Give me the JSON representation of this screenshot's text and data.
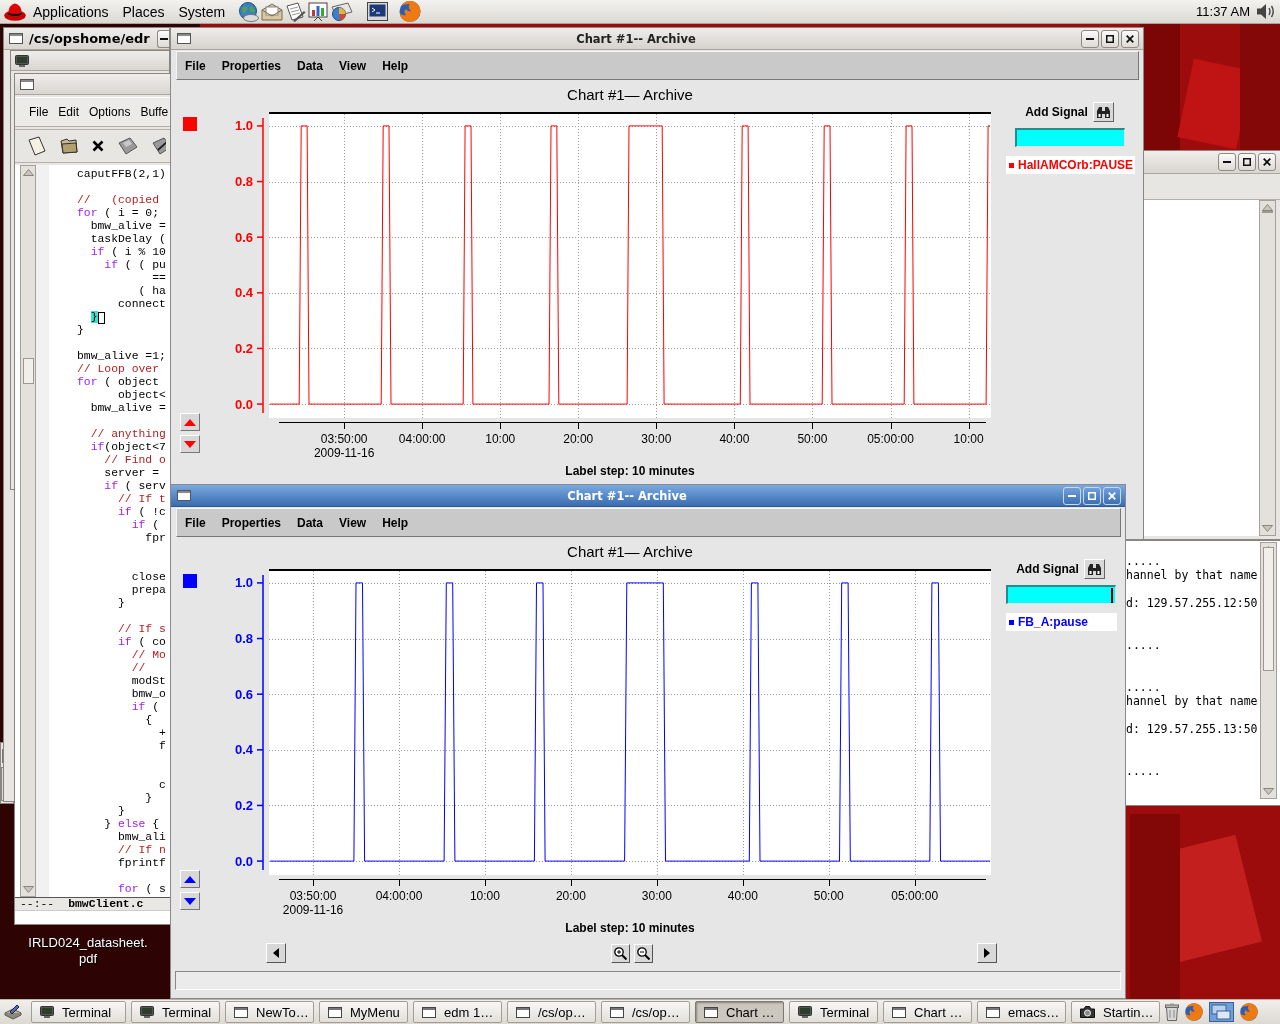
{
  "top_panel": {
    "menus": [
      "Applications",
      "Places",
      "System"
    ],
    "clock": "11:37 AM"
  },
  "desktop_icon": {
    "label": "IRLD024_datasheet.pdf"
  },
  "terminal_window": {
    "title": "/cs/opshome/edr"
  },
  "editor": {
    "menu": [
      "File",
      "Edit",
      "Options",
      "Buffe"
    ],
    "lines": [
      {
        "kind": "code",
        "parts": [
          {
            "text": "caputFFB(2,1)",
            "kind": "plain"
          }
        ]
      },
      {
        "kind": "blank"
      },
      {
        "kind": "code",
        "parts": [
          {
            "text": "//   (copied",
            "kind": "comment"
          }
        ]
      },
      {
        "kind": "code",
        "parts": [
          {
            "text": "for",
            "kind": "keyword"
          },
          {
            "text": " ( i = 0;",
            "kind": "plain"
          }
        ]
      },
      {
        "kind": "code",
        "parts": [
          {
            "text": "  bmw_alive =",
            "kind": "plain"
          }
        ]
      },
      {
        "kind": "code",
        "parts": [
          {
            "text": "  taskDelay (",
            "kind": "plain"
          }
        ]
      },
      {
        "kind": "code",
        "parts": [
          {
            "text": "  if",
            "kind": "keyword"
          },
          {
            "text": " ( i % 10",
            "kind": "plain"
          }
        ]
      },
      {
        "kind": "code",
        "parts": [
          {
            "text": "    if",
            "kind": "keyword"
          },
          {
            "text": " ( ( pu",
            "kind": "plain"
          }
        ]
      },
      {
        "kind": "code",
        "parts": [
          {
            "text": "           ==",
            "kind": "plain"
          }
        ]
      },
      {
        "kind": "code",
        "parts": [
          {
            "text": "         ( ha",
            "kind": "plain"
          }
        ]
      },
      {
        "kind": "code",
        "parts": [
          {
            "text": "      connect",
            "kind": "plain"
          }
        ]
      },
      {
        "kind": "code",
        "parts": [
          {
            "text": "  }",
            "kind": "match"
          },
          {
            "kind": "cursor"
          }
        ]
      },
      {
        "kind": "code",
        "parts": [
          {
            "text": "}",
            "kind": "plain"
          }
        ]
      },
      {
        "kind": "blank"
      },
      {
        "kind": "code",
        "parts": [
          {
            "text": "bmw_alive =1;",
            "kind": "plain"
          }
        ]
      },
      {
        "kind": "code",
        "parts": [
          {
            "text": "// Loop over",
            "kind": "comment"
          }
        ]
      },
      {
        "kind": "code",
        "parts": [
          {
            "text": "for",
            "kind": "keyword"
          },
          {
            "text": " ( object",
            "kind": "plain"
          }
        ]
      },
      {
        "kind": "code",
        "parts": [
          {
            "text": "      object<",
            "kind": "plain"
          }
        ]
      },
      {
        "kind": "code",
        "parts": [
          {
            "text": "  bmw_alive =",
            "kind": "plain"
          }
        ]
      },
      {
        "kind": "blank"
      },
      {
        "kind": "code",
        "parts": [
          {
            "text": "  // anything",
            "kind": "comment"
          }
        ]
      },
      {
        "kind": "code",
        "parts": [
          {
            "text": "  if",
            "kind": "keyword"
          },
          {
            "text": "(object<7",
            "kind": "plain"
          }
        ]
      },
      {
        "kind": "code",
        "parts": [
          {
            "text": "    // Find o",
            "kind": "comment"
          }
        ]
      },
      {
        "kind": "code",
        "parts": [
          {
            "text": "    server =",
            "kind": "plain"
          }
        ]
      },
      {
        "kind": "code",
        "parts": [
          {
            "text": "    if",
            "kind": "keyword"
          },
          {
            "text": " ( serv",
            "kind": "plain"
          }
        ]
      },
      {
        "kind": "code",
        "parts": [
          {
            "text": "      // If t",
            "kind": "comment"
          }
        ]
      },
      {
        "kind": "code",
        "parts": [
          {
            "text": "      if",
            "kind": "keyword"
          },
          {
            "text": " ( !c",
            "kind": "plain"
          }
        ]
      },
      {
        "kind": "code",
        "parts": [
          {
            "text": "        if",
            "kind": "keyword"
          },
          {
            "text": " (",
            "kind": "plain"
          }
        ]
      },
      {
        "kind": "code",
        "parts": [
          {
            "text": "          fpr",
            "kind": "plain"
          }
        ]
      },
      {
        "kind": "blank"
      },
      {
        "kind": "blank"
      },
      {
        "kind": "code",
        "parts": [
          {
            "text": "        close",
            "kind": "plain"
          }
        ]
      },
      {
        "kind": "code",
        "parts": [
          {
            "text": "        prepa",
            "kind": "plain"
          }
        ]
      },
      {
        "kind": "code",
        "parts": [
          {
            "text": "      }",
            "kind": "plain"
          }
        ]
      },
      {
        "kind": "blank"
      },
      {
        "kind": "code",
        "parts": [
          {
            "text": "      // If s",
            "kind": "comment"
          }
        ]
      },
      {
        "kind": "code",
        "parts": [
          {
            "text": "      if",
            "kind": "keyword"
          },
          {
            "text": " ( co",
            "kind": "plain"
          }
        ]
      },
      {
        "kind": "code",
        "parts": [
          {
            "text": "        // Mo",
            "kind": "comment"
          }
        ]
      },
      {
        "kind": "code",
        "parts": [
          {
            "text": "        //",
            "kind": "comment"
          }
        ]
      },
      {
        "kind": "code",
        "parts": [
          {
            "text": "        modSt",
            "kind": "plain"
          }
        ]
      },
      {
        "kind": "code",
        "parts": [
          {
            "text": "        bmw_o",
            "kind": "plain"
          }
        ]
      },
      {
        "kind": "code",
        "parts": [
          {
            "text": "        if",
            "kind": "keyword"
          },
          {
            "text": " (",
            "kind": "plain"
          }
        ]
      },
      {
        "kind": "code",
        "parts": [
          {
            "text": "          {",
            "kind": "plain"
          }
        ]
      },
      {
        "kind": "code",
        "parts": [
          {
            "text": "            +",
            "kind": "plain"
          }
        ]
      },
      {
        "kind": "code",
        "parts": [
          {
            "text": "            f",
            "kind": "plain"
          }
        ]
      },
      {
        "kind": "blank"
      },
      {
        "kind": "blank"
      },
      {
        "kind": "code",
        "parts": [
          {
            "text": "            c",
            "kind": "plain"
          }
        ]
      },
      {
        "kind": "code",
        "parts": [
          {
            "text": "          }",
            "kind": "plain"
          }
        ]
      },
      {
        "kind": "code",
        "parts": [
          {
            "text": "      }",
            "kind": "plain"
          }
        ]
      },
      {
        "kind": "code",
        "parts": [
          {
            "text": "    } ",
            "kind": "plain"
          },
          {
            "text": "else",
            "kind": "keyword"
          },
          {
            "text": " {",
            "kind": "plain"
          }
        ]
      },
      {
        "kind": "code",
        "parts": [
          {
            "text": "      bmw_ali",
            "kind": "plain"
          }
        ]
      },
      {
        "kind": "code",
        "parts": [
          {
            "text": "      // If n",
            "kind": "comment"
          }
        ]
      },
      {
        "kind": "code",
        "parts": [
          {
            "text": "      fprintf",
            "kind": "plain"
          }
        ]
      },
      {
        "kind": "blank"
      },
      {
        "kind": "code",
        "parts": [
          {
            "text": "      for",
            "kind": "keyword"
          },
          {
            "text": " ( s",
            "kind": "plain"
          }
        ]
      }
    ],
    "mode_line": {
      "status": "--:--",
      "buffer": "bmwClient.c"
    }
  },
  "log_window": {
    "lines": [
      {
        "text": ".....",
        "kind": "separator"
      },
      {
        "text": "hannel by that name",
        "kind": "message"
      },
      {
        "text": "d: 129.57.255.12:50",
        "kind": "address"
      },
      {
        "text": ".....",
        "kind": "separator"
      },
      {
        "text": ".....",
        "kind": "separator"
      },
      {
        "text": "hannel by that name",
        "kind": "message"
      },
      {
        "text": "d: 129.57.255.13:50",
        "kind": "address"
      },
      {
        "text": ".....",
        "kind": "separator"
      }
    ]
  },
  "chart_windows": [
    {
      "title": "Chart #1-- Archive",
      "active": false,
      "menu": [
        "File",
        "Properties",
        "Data",
        "View",
        "Help"
      ],
      "add_signal_label": "Add Signal",
      "date_label": "2009-11-16",
      "chart_data": {
        "type": "line",
        "title": "Chart #1— Archive",
        "xlabel": "Label step: 10 minutes",
        "grid": true,
        "categories": [
          null,
          null,
          null,
          null,
          null,
          null,
          null,
          null,
          null,
          null,
          null,
          null,
          null,
          null,
          null,
          null,
          null,
          null,
          null,
          null,
          null,
          null,
          null,
          null,
          null,
          null,
          null,
          null,
          null,
          null,
          null,
          null,
          null,
          null,
          null,
          null,
          null,
          null,
          "03:50:00",
          null,
          null,
          null,
          null,
          null,
          null,
          null,
          null,
          null,
          null,
          null,
          null,
          null,
          null,
          null,
          null,
          null,
          null,
          null,
          null,
          null,
          null,
          null,
          null,
          null,
          null,
          null,
          null,
          null,
          null,
          null,
          null,
          null,
          null,
          null,
          null,
          null,
          null,
          null,
          "04:00:00",
          null,
          null,
          null,
          null,
          null,
          null,
          null,
          null,
          null,
          null,
          null,
          null,
          null,
          null,
          null,
          null,
          null,
          null,
          null,
          null,
          null,
          null,
          null,
          null,
          null,
          null,
          null,
          null,
          null,
          null,
          null,
          null,
          null,
          null,
          null,
          null,
          null,
          null,
          null,
          "10:00",
          null,
          null,
          null,
          null,
          null,
          null,
          null,
          null,
          null,
          null,
          null,
          null,
          null,
          null,
          null,
          null,
          null,
          null,
          null,
          null,
          null,
          null,
          null,
          null,
          null,
          null,
          null,
          null,
          null,
          null,
          null,
          null,
          null,
          null,
          null,
          null,
          null,
          null,
          null,
          "20:00",
          null,
          null,
          null,
          null,
          null,
          null,
          null,
          null,
          null,
          null,
          null,
          null,
          null,
          null,
          null,
          null,
          null,
          null,
          null,
          null,
          null,
          null,
          null,
          null,
          null,
          null,
          null,
          null,
          null,
          null,
          null,
          null,
          null,
          null,
          null,
          null,
          null,
          null,
          null,
          "30:00",
          null,
          null,
          null,
          null,
          null,
          null,
          null,
          null,
          null,
          null,
          null,
          null,
          null,
          null,
          null,
          null,
          null,
          null,
          null,
          null,
          null,
          null,
          null,
          null,
          null,
          null,
          null,
          null,
          null,
          null,
          null,
          null,
          null,
          null,
          null,
          null,
          null,
          null,
          null,
          "40:00",
          null,
          null,
          null,
          null,
          null,
          null,
          null,
          null,
          null,
          null,
          null,
          null,
          null,
          null,
          null,
          null,
          null,
          null,
          null,
          null,
          null,
          null,
          null,
          null,
          null,
          null,
          null,
          null,
          null,
          null,
          null,
          null,
          null,
          null,
          null,
          null,
          null,
          null,
          null,
          "50:00",
          null,
          null,
          null,
          null,
          null,
          null,
          null,
          null,
          null,
          null,
          null,
          null,
          null,
          null,
          null,
          null,
          null,
          null,
          null,
          null,
          null,
          null,
          null,
          null,
          null,
          null,
          null,
          null,
          null,
          null,
          null,
          null,
          null,
          null,
          null,
          null,
          null,
          null,
          null,
          "05:00:00",
          null,
          null,
          null,
          null,
          null,
          null,
          null,
          null,
          null,
          null,
          null,
          null,
          null,
          null,
          null,
          null,
          null,
          null,
          null,
          null,
          null,
          null,
          null,
          null,
          null,
          null,
          null,
          null,
          null,
          null,
          null,
          null,
          null,
          null,
          null,
          null,
          null,
          null,
          null,
          "10:00",
          null,
          null,
          null,
          null,
          null,
          null,
          null,
          null,
          null,
          null,
          null
        ],
        "series": [
          {
            "name": "HallAMCOrb:PAUSE",
            "color": "#ff0000",
            "values": [
              0,
              0,
              0,
              0,
              0,
              0,
              0,
              0,
              0,
              0,
              0,
              0,
              0,
              0,
              0,
              0,
              1,
              1,
              1,
              1,
              0,
              0,
              0,
              0,
              0,
              0,
              0,
              0,
              0,
              0,
              0,
              0,
              0,
              0,
              0,
              0,
              0,
              0,
              0,
              0,
              0,
              0,
              0,
              0,
              0,
              0,
              0,
              0,
              0,
              0,
              0,
              0,
              0,
              0,
              0,
              0,
              0,
              0,
              1,
              1,
              1,
              1,
              0,
              0,
              0,
              0,
              0,
              0,
              0,
              0,
              0,
              0,
              0,
              0,
              0,
              0,
              0,
              0,
              0,
              0,
              0,
              0,
              0,
              0,
              0,
              0,
              0,
              0,
              0,
              0,
              0,
              0,
              0,
              0,
              0,
              0,
              0,
              0,
              0,
              0,
              1,
              1,
              1,
              1,
              0,
              0,
              0,
              0,
              0,
              0,
              0,
              0,
              0,
              0,
              0,
              0,
              0,
              0,
              0,
              0,
              0,
              0,
              0,
              0,
              0,
              0,
              0,
              0,
              0,
              0,
              0,
              0,
              0,
              0,
              0,
              0,
              0,
              0,
              0,
              0,
              0,
              0,
              0,
              0,
              1,
              1,
              1,
              1,
              0,
              0,
              0,
              0,
              0,
              0,
              0,
              0,
              0,
              0,
              0,
              0,
              0,
              0,
              0,
              0,
              0,
              0,
              0,
              0,
              0,
              0,
              0,
              0,
              0,
              0,
              0,
              0,
              0,
              0,
              0,
              0,
              0,
              0,
              0,
              0,
              1,
              1,
              1,
              1,
              1,
              1,
              1,
              1,
              1,
              1,
              1,
              1,
              1,
              1,
              1,
              1,
              1,
              1,
              0,
              0,
              0,
              0,
              0,
              0,
              0,
              0,
              0,
              0,
              0,
              0,
              0,
              0,
              0,
              0,
              0,
              0,
              0,
              0,
              0,
              0,
              0,
              0,
              0,
              0,
              0,
              0,
              0,
              0,
              0,
              0,
              0,
              0,
              0,
              0,
              0,
              0,
              0,
              0,
              1,
              1,
              1,
              1,
              0,
              0,
              0,
              0,
              0,
              0,
              0,
              0,
              0,
              0,
              0,
              0,
              0,
              0,
              0,
              0,
              0,
              0,
              0,
              0,
              0,
              0,
              0,
              0,
              0,
              0,
              0,
              0,
              0,
              0,
              0,
              0,
              0,
              0,
              0,
              0,
              0,
              0,
              1,
              1,
              1,
              1,
              0,
              0,
              0,
              0,
              0,
              0,
              0,
              0,
              0,
              0,
              0,
              0,
              0,
              0,
              0,
              0,
              0,
              0,
              0,
              0,
              0,
              0,
              0,
              0,
              0,
              0,
              0,
              0,
              0,
              0,
              0,
              0,
              0,
              0,
              0,
              0,
              0,
              0,
              1,
              1,
              1,
              1,
              0,
              0,
              0,
              0,
              0,
              0,
              0,
              0,
              0,
              0,
              0,
              0,
              0,
              0,
              0,
              0,
              0,
              0,
              0,
              0,
              0,
              0,
              0,
              0,
              0,
              0,
              0,
              0,
              0,
              0,
              0,
              0,
              0,
              0,
              0,
              0,
              0,
              0,
              1,
              1
            ]
          }
        ],
        "ylim": [
          -0.05,
          1.05
        ],
        "yticks": [
          {
            "value": 0,
            "label": "0.0"
          },
          {
            "value": 0.2,
            "label": "0.2"
          },
          {
            "value": 0.4,
            "label": "0.4"
          },
          {
            "value": 0.6,
            "label": "0.6"
          },
          {
            "value": 0.8,
            "label": "0.8"
          },
          {
            "value": 1,
            "label": "1.0"
          }
        ]
      }
    },
    {
      "title": "Chart #1-- Archive",
      "active": true,
      "menu": [
        "File",
        "Properties",
        "Data",
        "View",
        "Help"
      ],
      "add_signal_label": "Add Signal",
      "date_label": "2009-11-16",
      "navigation": true,
      "chart_data": {
        "type": "line",
        "title": "Chart #1— Archive",
        "xlabel": "Label step: 10 minutes",
        "grid": true,
        "categories": [
          null,
          null,
          null,
          null,
          null,
          null,
          null,
          null,
          null,
          null,
          null,
          null,
          null,
          null,
          null,
          null,
          null,
          null,
          null,
          null,
          "03:50:00",
          null,
          null,
          null,
          null,
          null,
          null,
          null,
          null,
          null,
          null,
          null,
          null,
          null,
          null,
          null,
          null,
          null,
          null,
          null,
          null,
          null,
          null,
          null,
          null,
          null,
          null,
          null,
          null,
          null,
          null,
          null,
          null,
          null,
          null,
          null,
          null,
          null,
          null,
          null,
          "04:00:00",
          null,
          null,
          null,
          null,
          null,
          null,
          null,
          null,
          null,
          null,
          null,
          null,
          null,
          null,
          null,
          null,
          null,
          null,
          null,
          null,
          null,
          null,
          null,
          null,
          null,
          null,
          null,
          null,
          null,
          null,
          null,
          null,
          null,
          null,
          null,
          null,
          null,
          null,
          null,
          "10:00",
          null,
          null,
          null,
          null,
          null,
          null,
          null,
          null,
          null,
          null,
          null,
          null,
          null,
          null,
          null,
          null,
          null,
          null,
          null,
          null,
          null,
          null,
          null,
          null,
          null,
          null,
          null,
          null,
          null,
          null,
          null,
          null,
          null,
          null,
          null,
          null,
          null,
          null,
          null,
          "20:00",
          null,
          null,
          null,
          null,
          null,
          null,
          null,
          null,
          null,
          null,
          null,
          null,
          null,
          null,
          null,
          null,
          null,
          null,
          null,
          null,
          null,
          null,
          null,
          null,
          null,
          null,
          null,
          null,
          null,
          null,
          null,
          null,
          null,
          null,
          null,
          null,
          null,
          null,
          null,
          "30:00",
          null,
          null,
          null,
          null,
          null,
          null,
          null,
          null,
          null,
          null,
          null,
          null,
          null,
          null,
          null,
          null,
          null,
          null,
          null,
          null,
          null,
          null,
          null,
          null,
          null,
          null,
          null,
          null,
          null,
          null,
          null,
          null,
          null,
          null,
          null,
          null,
          null,
          null,
          null,
          "40:00",
          null,
          null,
          null,
          null,
          null,
          null,
          null,
          null,
          null,
          null,
          null,
          null,
          null,
          null,
          null,
          null,
          null,
          null,
          null,
          null,
          null,
          null,
          null,
          null,
          null,
          null,
          null,
          null,
          null,
          null,
          null,
          null,
          null,
          null,
          null,
          null,
          null,
          null,
          null,
          "50:00",
          null,
          null,
          null,
          null,
          null,
          null,
          null,
          null,
          null,
          null,
          null,
          null,
          null,
          null,
          null,
          null,
          null,
          null,
          null,
          null,
          null,
          null,
          null,
          null,
          null,
          null,
          null,
          null,
          null,
          null,
          null,
          null,
          null,
          null,
          null,
          null,
          null,
          null,
          null,
          "05:00:00",
          null,
          null,
          null,
          null,
          null,
          null,
          null,
          null,
          null,
          null,
          null,
          null,
          null,
          null,
          null,
          null,
          null,
          null,
          null,
          null,
          null,
          null,
          null,
          null,
          null,
          null,
          null,
          null,
          null,
          null,
          null,
          null,
          null,
          null,
          null
        ],
        "series": [
          {
            "name": "FB_A:pause",
            "color": "#0000ff",
            "values": [
              0,
              0,
              0,
              0,
              0,
              0,
              0,
              0,
              0,
              0,
              0,
              0,
              0,
              0,
              0,
              0,
              0,
              0,
              0,
              0,
              0,
              0,
              0,
              0,
              0,
              0,
              0,
              0,
              0,
              0,
              0,
              0,
              0,
              0,
              0,
              0,
              0,
              0,
              0,
              0,
              1,
              1,
              1,
              1,
              0,
              0,
              0,
              0,
              0,
              0,
              0,
              0,
              0,
              0,
              0,
              0,
              0,
              0,
              0,
              0,
              0,
              0,
              0,
              0,
              0,
              0,
              0,
              0,
              0,
              0,
              0,
              0,
              0,
              0,
              0,
              0,
              0,
              0,
              0,
              0,
              0,
              0,
              1,
              1,
              1,
              1,
              0,
              0,
              0,
              0,
              0,
              0,
              0,
              0,
              0,
              0,
              0,
              0,
              0,
              0,
              0,
              0,
              0,
              0,
              0,
              0,
              0,
              0,
              0,
              0,
              0,
              0,
              0,
              0,
              0,
              0,
              0,
              0,
              0,
              0,
              0,
              0,
              0,
              0,
              1,
              1,
              1,
              1,
              0,
              0,
              0,
              0,
              0,
              0,
              0,
              0,
              0,
              0,
              0,
              0,
              0,
              0,
              0,
              0,
              0,
              0,
              0,
              0,
              0,
              0,
              0,
              0,
              0,
              0,
              0,
              0,
              0,
              0,
              0,
              0,
              0,
              0,
              0,
              0,
              0,
              0,
              1,
              1,
              1,
              1,
              1,
              1,
              1,
              1,
              1,
              1,
              1,
              1,
              1,
              1,
              1,
              1,
              1,
              1,
              0,
              0,
              0,
              0,
              0,
              0,
              0,
              0,
              0,
              0,
              0,
              0,
              0,
              0,
              0,
              0,
              0,
              0,
              0,
              0,
              0,
              0,
              0,
              0,
              0,
              0,
              0,
              0,
              0,
              0,
              0,
              0,
              0,
              0,
              0,
              0,
              0,
              0,
              0,
              0,
              1,
              1,
              1,
              1,
              0,
              0,
              0,
              0,
              0,
              0,
              0,
              0,
              0,
              0,
              0,
              0,
              0,
              0,
              0,
              0,
              0,
              0,
              0,
              0,
              0,
              0,
              0,
              0,
              0,
              0,
              0,
              0,
              0,
              0,
              0,
              0,
              0,
              0,
              0,
              0,
              0,
              0,
              1,
              1,
              1,
              1,
              0,
              0,
              0,
              0,
              0,
              0,
              0,
              0,
              0,
              0,
              0,
              0,
              0,
              0,
              0,
              0,
              0,
              0,
              0,
              0,
              0,
              0,
              0,
              0,
              0,
              0,
              0,
              0,
              0,
              0,
              0,
              0,
              0,
              0,
              0,
              0,
              0,
              0,
              1,
              1,
              1,
              1,
              0,
              0,
              0,
              0,
              0,
              0,
              0,
              0,
              0,
              0,
              0,
              0,
              0,
              0,
              0,
              0,
              0,
              0,
              0,
              0,
              0,
              0,
              0,
              0
            ]
          }
        ],
        "ylim": [
          -0.05,
          1.05
        ],
        "yticks": [
          {
            "value": 0,
            "label": "0.0"
          },
          {
            "value": 0.2,
            "label": "0.2"
          },
          {
            "value": 0.4,
            "label": "0.4"
          },
          {
            "value": 0.6,
            "label": "0.6"
          },
          {
            "value": 0.8,
            "label": "0.8"
          },
          {
            "value": 1,
            "label": "1.0"
          }
        ]
      }
    }
  ],
  "taskbar": {
    "items": [
      {
        "label": "Terminal",
        "kind": "terminal",
        "selected": false
      },
      {
        "label": "Terminal",
        "kind": "terminal",
        "selected": false
      },
      {
        "label": "NewTo…",
        "kind": "window",
        "selected": false
      },
      {
        "label": "MyMenu",
        "kind": "window",
        "selected": false
      },
      {
        "label": "edm 1…",
        "kind": "window",
        "selected": false
      },
      {
        "label": "/cs/op…",
        "kind": "window",
        "selected": false
      },
      {
        "label": "/cs/op…",
        "kind": "window",
        "selected": false
      },
      {
        "label": "Chart …",
        "kind": "window",
        "selected": true
      },
      {
        "label": "Terminal",
        "kind": "terminal",
        "selected": false
      },
      {
        "label": "Chart …",
        "kind": "window",
        "selected": false
      },
      {
        "label": "emacs…",
        "kind": "window",
        "selected": false
      },
      {
        "label": "Startin…",
        "kind": "camera",
        "selected": false
      }
    ]
  }
}
